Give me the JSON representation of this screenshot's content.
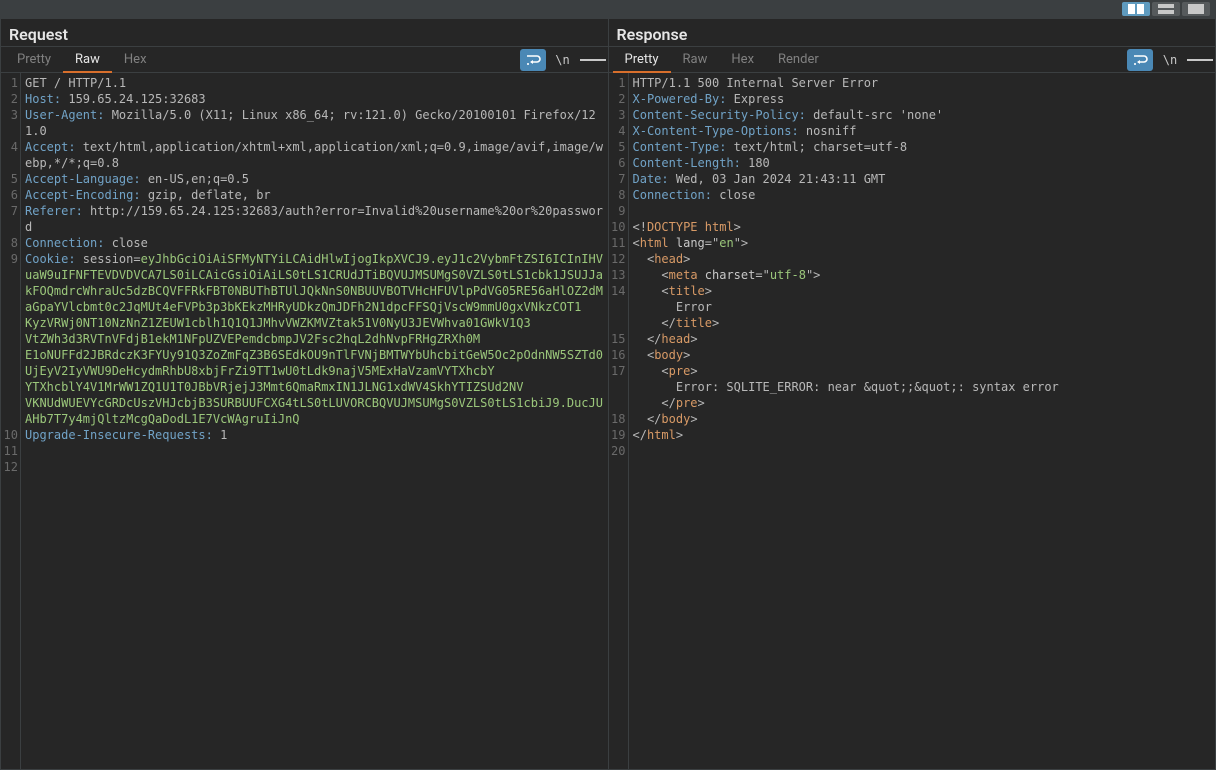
{
  "layout": {
    "buttons": [
      "split-horizontal",
      "split-vertical",
      "single"
    ]
  },
  "request": {
    "title": "Request",
    "tabs": [
      "Pretty",
      "Raw",
      "Hex"
    ],
    "activeTab": "Raw",
    "lines": [
      {
        "n": 1,
        "segs": [
          {
            "c": "v",
            "t": "GET / HTTP/1.1"
          }
        ]
      },
      {
        "n": 2,
        "segs": [
          {
            "c": "k",
            "t": "Host:"
          },
          {
            "c": "v",
            "t": " 159.65.24.125:32683"
          }
        ]
      },
      {
        "n": 3,
        "segs": [
          {
            "c": "k",
            "t": "User-Agent:"
          },
          {
            "c": "v",
            "t": " Mozilla/5.0 (X11; Linux x86_64; rv:121.0) Gecko/20100101 Firefox/121.0"
          }
        ]
      },
      {
        "n": 4,
        "segs": [
          {
            "c": "k",
            "t": "Accept:"
          },
          {
            "c": "v",
            "t": " text/html,application/xhtml+xml,application/xml;q=0.9,image/avif,image/webp,*/*;q=0.8"
          }
        ]
      },
      {
        "n": 5,
        "segs": [
          {
            "c": "k",
            "t": "Accept-Language:"
          },
          {
            "c": "v",
            "t": " en-US,en;q=0.5"
          }
        ]
      },
      {
        "n": 6,
        "segs": [
          {
            "c": "k",
            "t": "Accept-Encoding:"
          },
          {
            "c": "v",
            "t": " gzip, deflate, br"
          }
        ]
      },
      {
        "n": 7,
        "segs": [
          {
            "c": "k",
            "t": "Referer:"
          },
          {
            "c": "v",
            "t": " http://159.65.24.125:32683/auth?error=Invalid%20username%20or%20password"
          }
        ]
      },
      {
        "n": 8,
        "segs": [
          {
            "c": "k",
            "t": "Connection:"
          },
          {
            "c": "v",
            "t": " close"
          }
        ]
      },
      {
        "n": 9,
        "segs": [
          {
            "c": "k",
            "t": "Cookie:"
          },
          {
            "c": "v",
            "t": " session="
          },
          {
            "c": "sel",
            "t": "eyJhbGciOiAiSFMyNTYiLCAidHlwIjogIkpXVCJ9.eyJ1c2VybmFtZSI6ICInIHVuaW9uIFNFTEVDVDVCA7LS0iLCAicGsiOiAiLS0tLS1CRUdJTiBQVUJMSUMgS0VZLS0tLS1cbk1JSUJJakFOQmdrcWhraUc5dzBCQVFFRkFBT0NBUThBTUlJQkNnS0NBUUVBOTVHcHFUVlpPdVG05RE56aHlOZ2dM\naGpaYVlcbmt0c2JqMUt4eFVPb3p3bKEkzMHRyUDkzQmJDFh2N1dpcFFSQjVscW9mmU0gxVNkzCOT1\nKyzVRWj0NT10NzNnZ1ZEUW1cblh1Q1Q1JMhvVWZKMVZtak51V0NyU3JEVWhva01GWkV1Q3\nVtZWh3d3RVTnVFdjB1ekM1NFpUZVEPemdcbmpJV2Fsc2hqL2dhNvpFRHgZRXh0M\nE1oNUFFd2JBRdczK3FYUy91Q3ZoZmFqZ3B6SEdkOU9nTlFVNjBMTWYbUhcbitGeW5Oc2pOdnNW5SZTd0UjEyV2IyVWU9DeHcydmRhbU8xbjFrZi9TT1wU0tLdk9najV5MExHaVzamVYTXhcbY\nYTXhcblY4V1MrWW1ZQ1U1T0JBbVRjejJ3Mmt6QmaRmxIN1JLNG1xdWV4SkhYTIZSUd2NV\nVKNUdWUEVYcGRDcUszVHJcbjB3SURBUUFCXG4tLS0tLUVORCBQVUJMSUMgS0VZLS0tLS1cbiJ9.DucJUAHb7T7y4mjQltzMcgQaDodL1E7VcWAgruIiJnQ"
          }
        ]
      },
      {
        "n": 10,
        "segs": [
          {
            "c": "k",
            "t": "Upgrade-Insecure-Requests:"
          },
          {
            "c": "v",
            "t": " 1"
          }
        ]
      },
      {
        "n": 11,
        "segs": []
      },
      {
        "n": 12,
        "segs": []
      }
    ]
  },
  "response": {
    "title": "Response",
    "tabs": [
      "Pretty",
      "Raw",
      "Hex",
      "Render"
    ],
    "activeTab": "Pretty",
    "lines": [
      {
        "n": 1,
        "segs": [
          {
            "c": "v",
            "t": "HTTP/1.1 500 Internal Server Error"
          }
        ]
      },
      {
        "n": 2,
        "segs": [
          {
            "c": "k",
            "t": "X-Powered-By:"
          },
          {
            "c": "v",
            "t": " Express"
          }
        ]
      },
      {
        "n": 3,
        "segs": [
          {
            "c": "k",
            "t": "Content-Security-Policy:"
          },
          {
            "c": "v",
            "t": " default-src 'none'"
          }
        ]
      },
      {
        "n": 4,
        "segs": [
          {
            "c": "k",
            "t": "X-Content-Type-Options:"
          },
          {
            "c": "v",
            "t": " nosniff"
          }
        ]
      },
      {
        "n": 5,
        "segs": [
          {
            "c": "k",
            "t": "Content-Type:"
          },
          {
            "c": "v",
            "t": " text/html; charset=utf-8"
          }
        ]
      },
      {
        "n": 6,
        "segs": [
          {
            "c": "k",
            "t": "Content-Length:"
          },
          {
            "c": "v",
            "t": " 180"
          }
        ]
      },
      {
        "n": 7,
        "segs": [
          {
            "c": "k",
            "t": "Date:"
          },
          {
            "c": "v",
            "t": " Wed, 03 Jan 2024 21:43:11 GMT"
          }
        ]
      },
      {
        "n": 8,
        "segs": [
          {
            "c": "k",
            "t": "Connection:"
          },
          {
            "c": "v",
            "t": " close"
          }
        ]
      },
      {
        "n": 9,
        "segs": []
      },
      {
        "n": 10,
        "segs": [
          {
            "c": "pun",
            "t": "<!"
          },
          {
            "c": "tag",
            "t": "DOCTYPE html"
          },
          {
            "c": "pun",
            "t": ">"
          }
        ]
      },
      {
        "n": 11,
        "segs": [
          {
            "c": "pun",
            "t": "<"
          },
          {
            "c": "tag",
            "t": "html"
          },
          {
            "c": "v",
            "t": " "
          },
          {
            "c": "attr",
            "t": "lang"
          },
          {
            "c": "pun",
            "t": "=\""
          },
          {
            "c": "str",
            "t": "en"
          },
          {
            "c": "pun",
            "t": "\">"
          }
        ]
      },
      {
        "n": 12,
        "segs": [
          {
            "c": "v",
            "t": "  "
          },
          {
            "c": "pun",
            "t": "<"
          },
          {
            "c": "tag",
            "t": "head"
          },
          {
            "c": "pun",
            "t": ">"
          }
        ]
      },
      {
        "n": 13,
        "segs": [
          {
            "c": "v",
            "t": "    "
          },
          {
            "c": "pun",
            "t": "<"
          },
          {
            "c": "tag",
            "t": "meta"
          },
          {
            "c": "v",
            "t": " "
          },
          {
            "c": "attr",
            "t": "charset"
          },
          {
            "c": "pun",
            "t": "=\""
          },
          {
            "c": "str",
            "t": "utf-8"
          },
          {
            "c": "pun",
            "t": "\">"
          }
        ]
      },
      {
        "n": 14,
        "segs": [
          {
            "c": "v",
            "t": "    "
          },
          {
            "c": "pun",
            "t": "<"
          },
          {
            "c": "tag",
            "t": "title"
          },
          {
            "c": "pun",
            "t": ">"
          }
        ]
      },
      {
        "n": "",
        "segs": [
          {
            "c": "v",
            "t": "      Error"
          }
        ]
      },
      {
        "n": "",
        "segs": [
          {
            "c": "v",
            "t": "    "
          },
          {
            "c": "pun",
            "t": "</"
          },
          {
            "c": "tag",
            "t": "title"
          },
          {
            "c": "pun",
            "t": ">"
          }
        ]
      },
      {
        "n": 15,
        "segs": [
          {
            "c": "v",
            "t": "  "
          },
          {
            "c": "pun",
            "t": "</"
          },
          {
            "c": "tag",
            "t": "head"
          },
          {
            "c": "pun",
            "t": ">"
          }
        ]
      },
      {
        "n": 16,
        "segs": [
          {
            "c": "v",
            "t": "  "
          },
          {
            "c": "pun",
            "t": "<"
          },
          {
            "c": "tag",
            "t": "body"
          },
          {
            "c": "pun",
            "t": ">"
          }
        ]
      },
      {
        "n": 17,
        "segs": [
          {
            "c": "v",
            "t": "    "
          },
          {
            "c": "pun",
            "t": "<"
          },
          {
            "c": "tag",
            "t": "pre"
          },
          {
            "c": "pun",
            "t": ">"
          }
        ]
      },
      {
        "n": "",
        "segs": [
          {
            "c": "v",
            "t": "      Error: SQLITE_ERROR: near &quot;;&quot;: syntax error"
          }
        ]
      },
      {
        "n": "",
        "segs": [
          {
            "c": "v",
            "t": "    "
          },
          {
            "c": "pun",
            "t": "</"
          },
          {
            "c": "tag",
            "t": "pre"
          },
          {
            "c": "pun",
            "t": ">"
          }
        ]
      },
      {
        "n": 18,
        "segs": [
          {
            "c": "v",
            "t": "  "
          },
          {
            "c": "pun",
            "t": "</"
          },
          {
            "c": "tag",
            "t": "body"
          },
          {
            "c": "pun",
            "t": ">"
          }
        ]
      },
      {
        "n": 19,
        "segs": [
          {
            "c": "pun",
            "t": "</"
          },
          {
            "c": "tag",
            "t": "html"
          },
          {
            "c": "pun",
            "t": ">"
          }
        ]
      },
      {
        "n": 20,
        "segs": []
      }
    ]
  }
}
